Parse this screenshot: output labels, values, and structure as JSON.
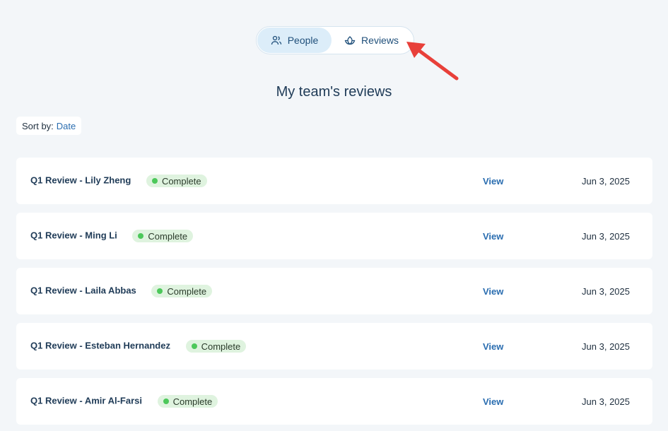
{
  "toggle": {
    "people_label": "People",
    "reviews_label": "Reviews",
    "active": "Reviews"
  },
  "page": {
    "title": "My team's reviews"
  },
  "sort": {
    "label": "Sort by:",
    "value": "Date"
  },
  "reviews": [
    {
      "title": "Q1 Review - Lily Zheng",
      "status": "Complete",
      "action": "View",
      "date": "Jun 3, 2025"
    },
    {
      "title": "Q1 Review - Ming Li",
      "status": "Complete",
      "action": "View",
      "date": "Jun 3, 2025"
    },
    {
      "title": "Q1 Review - Laila Abbas",
      "status": "Complete",
      "action": "View",
      "date": "Jun 3, 2025"
    },
    {
      "title": "Q1 Review - Esteban Hernandez",
      "status": "Complete",
      "action": "View",
      "date": "Jun 3, 2025"
    },
    {
      "title": "Q1 Review - Amir Al-Farsi",
      "status": "Complete",
      "action": "View",
      "date": "Jun 3, 2025"
    }
  ],
  "colors": {
    "background": "#f3f6f9",
    "accent": "#2a6db0",
    "status_complete": "#4cc85a",
    "annotation_arrow": "#e8403a"
  },
  "icons": {
    "people": "people-icon",
    "reviews": "lotus-icon"
  }
}
